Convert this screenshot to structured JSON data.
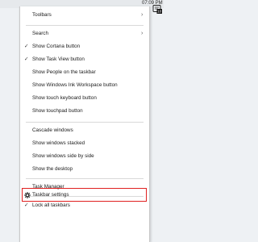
{
  "clock": "07:09 PM",
  "notifications": {
    "count": "10"
  },
  "menu": {
    "toolbars": "Toolbars",
    "search": "Search",
    "show_cortana": "Show Cortana button",
    "show_task_view": "Show Task View button",
    "show_people": "Show People on the taskbar",
    "show_ink": "Show Windows Ink Workspace button",
    "show_keyboard": "Show touch keyboard button",
    "show_touchpad": "Show touchpad button",
    "cascade": "Cascade windows",
    "stacked": "Show windows stacked",
    "side_by_side": "Show windows side by side",
    "desktop": "Show the desktop",
    "task_manager": "Task Manager",
    "lock": "Lock all taskbars",
    "settings": "Taskbar settings"
  },
  "icons": {
    "check": "check-icon",
    "submenu": "chevron-right-icon",
    "settings": "gear-icon",
    "notifications": "notification-icon"
  },
  "colors": {
    "highlight": "#e02020"
  }
}
